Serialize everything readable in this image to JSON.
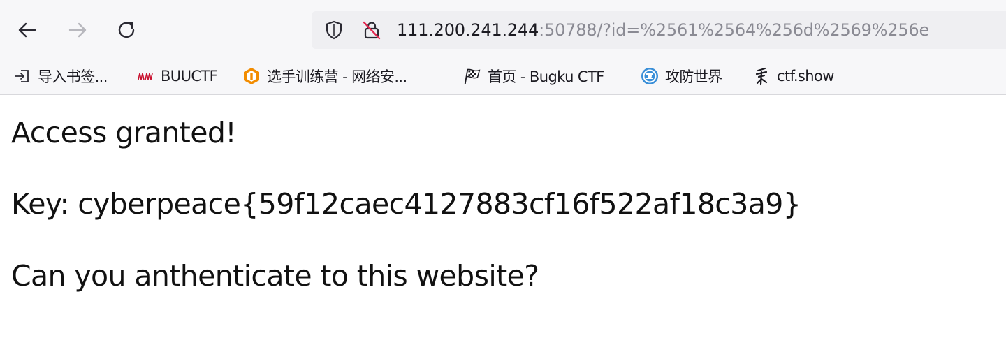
{
  "browser": {
    "url": {
      "host": "111.200.241.244",
      "rest": ":50788/?id=%2561%2564%256d%2569%256e"
    },
    "icons": {
      "back": "arrow-left-icon",
      "forward": "arrow-right-icon",
      "reload": "reload-icon",
      "shield": "shield-icon",
      "insecure": "lock-slash-icon"
    },
    "bookmarks": [
      {
        "label": "导入书签...",
        "icon": "import-icon"
      },
      {
        "label": "BUUCTF",
        "icon": "buuctf-icon"
      },
      {
        "label": "选手训练营 - 网络安...",
        "icon": "camp-icon"
      },
      {
        "label": "首页 - Bugku CTF",
        "icon": "flag-icon"
      },
      {
        "label": "攻防世界",
        "icon": "globe-icon"
      },
      {
        "label": "ctf.show",
        "icon": "ctfshow-icon"
      }
    ]
  },
  "page": {
    "line1": "Access granted!",
    "line2": "Key: cyberpeace{59f12caec4127883cf16f522af18c3a9}",
    "line3": "Can you anthenticate to this website?"
  },
  "colors": {
    "chrome_bg": "#f7f7f9",
    "urlbar_bg": "#efeff2",
    "text": "#111111",
    "url_dim": "#8a8a93",
    "buuctf_red": "#c8102e",
    "camp_orange": "#f28c00",
    "world_blue": "#3a8fd8"
  }
}
